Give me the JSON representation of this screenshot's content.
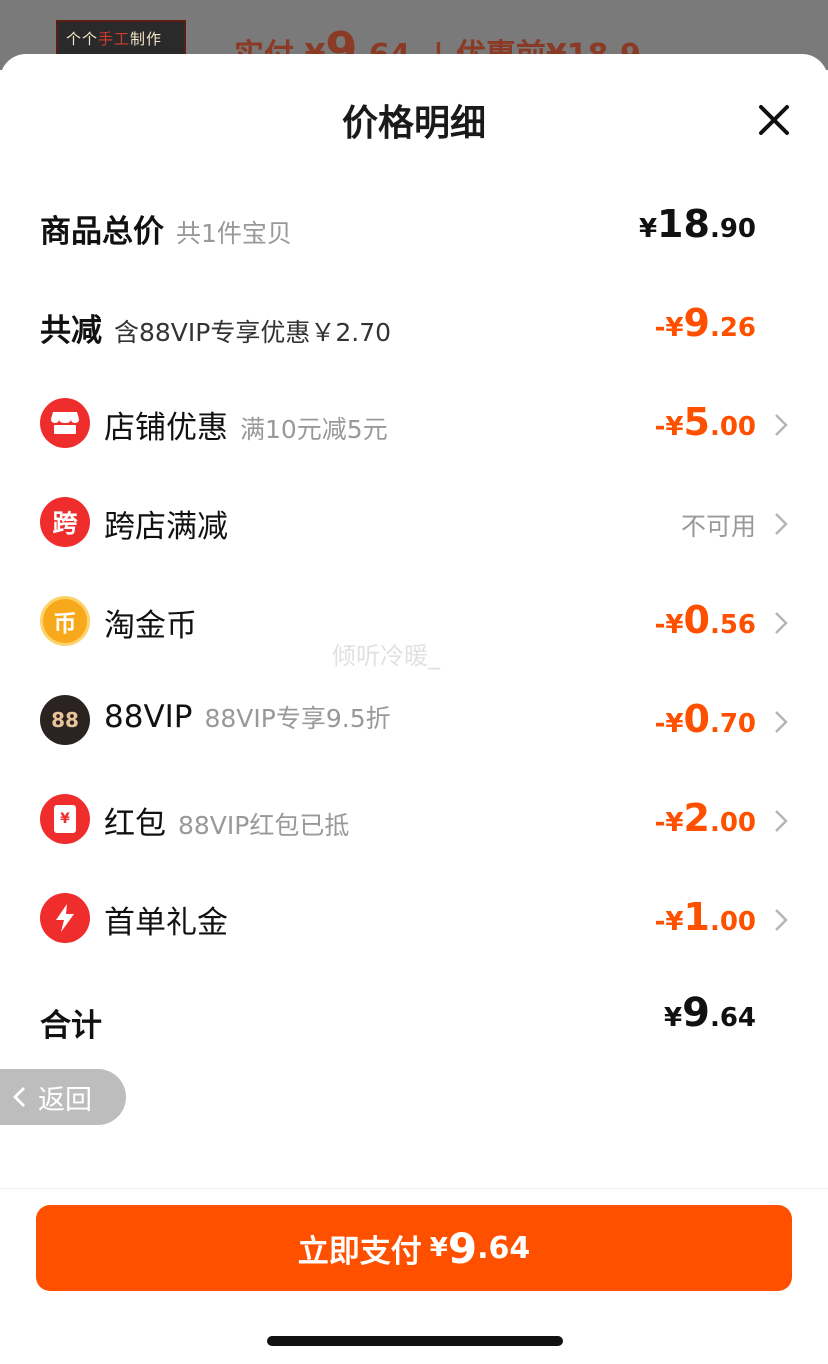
{
  "background": {
    "shop_badge": {
      "part1": "个个",
      "part2": "手工",
      "part3": "制作"
    },
    "price_peek": {
      "label": "实付",
      "currency": "¥",
      "integer": "9",
      "decimal": ".64",
      "separator": "|",
      "original": "优惠前¥18.9"
    }
  },
  "sheet": {
    "title": "价格明细"
  },
  "rows": {
    "goods_total": {
      "label": "商品总价",
      "sub": "共1件宝贝",
      "amount": {
        "currency": "¥",
        "integer": "18",
        "decimal": ".90"
      }
    },
    "total_discount": {
      "label": "共减",
      "sub": "含88VIP专享优惠￥2.70",
      "amount": {
        "prefix": "-¥",
        "integer": "9",
        "decimal": ".26"
      }
    },
    "shop_discount": {
      "icon": "shop-icon",
      "label": "店铺优惠",
      "sub": "满10元减5元",
      "amount": {
        "prefix": "-¥",
        "integer": "5",
        "decimal": ".00"
      }
    },
    "cross_store": {
      "icon": "cross-store-icon",
      "icon_char": "跨",
      "label": "跨店满减",
      "status": "不可用"
    },
    "taojinbi": {
      "icon": "coin-icon",
      "icon_char": "币",
      "label": "淘金币",
      "amount": {
        "prefix": "-¥",
        "integer": "0",
        "decimal": ".56"
      }
    },
    "vip88": {
      "icon": "88vip-icon",
      "icon_char": "88",
      "label": "88VIP",
      "sub": "88VIP专享9.5折",
      "amount": {
        "prefix": "-¥",
        "integer": "0",
        "decimal": ".70"
      }
    },
    "red_packet": {
      "icon": "red-packet-icon",
      "icon_char": "¥",
      "label": "红包",
      "sub": "88VIP红包已抵",
      "amount": {
        "prefix": "-¥",
        "integer": "2",
        "decimal": ".00"
      }
    },
    "first_order": {
      "icon": "lightning-icon",
      "label": "首单礼金",
      "amount": {
        "prefix": "-¥",
        "integer": "1",
        "decimal": ".00"
      }
    },
    "grand_total": {
      "label": "合计",
      "amount": {
        "currency": "¥",
        "integer": "9",
        "decimal": ".64"
      }
    }
  },
  "back_button": {
    "label": "返回"
  },
  "pay_button": {
    "label": "立即支付",
    "currency": "¥",
    "integer": "9",
    "decimal": ".64"
  },
  "watermark": "倾听冷暖_",
  "colors": {
    "accent": "#ff5000",
    "muted": "#999999",
    "red_icon": "#f02d2d",
    "coin": "#f8a91b",
    "vip_dark": "#2b2322"
  }
}
